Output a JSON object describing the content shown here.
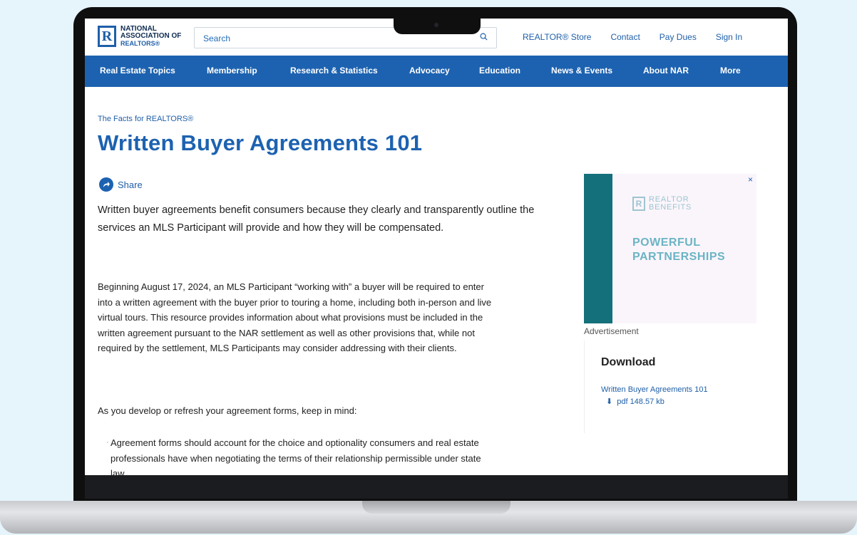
{
  "header": {
    "logo": {
      "line1": "NATIONAL",
      "line2": "ASSOCIATION OF",
      "line3": "REALTORS®"
    },
    "search_placeholder": "Search",
    "links": [
      "REALTOR® Store",
      "Contact",
      "Pay Dues",
      "Sign In"
    ]
  },
  "nav": {
    "items": [
      "Real Estate Topics",
      "Membership",
      "Research & Statistics",
      "Advocacy",
      "Education",
      "News & Events",
      "About NAR",
      "More"
    ]
  },
  "article": {
    "kicker": "The Facts for REALTORS®",
    "title": "Written Buyer Agreements 101",
    "share_label": "Share",
    "intro": "Written buyer agreements benefit consumers because they clearly and transparently outline the services an MLS Participant will provide and how they will be compensated.",
    "paragraph": "Beginning August 17, 2024, an MLS Participant “working with” a buyer will be required to enter into a written agreement with the buyer prior to touring a home, including both in-person and live virtual tours. This resource provides information about what provisions must be included in the written agreement pursuant to the NAR settlement as well as other provisions that, while not required by the settlement, MLS Participants may consider addressing with their clients.",
    "paragraph2": "As you develop or refresh your agreement forms, keep in mind:",
    "bullet": "Agreement forms should account for the choice and optionality consumers and real estate professionals have when negotiating the terms of their relationship permissible under state law."
  },
  "ad": {
    "logo_line1": "REALTOR",
    "logo_line2": "BENEFITS",
    "headline_line1": "POWERFUL",
    "headline_line2": "PARTNERSHIPS",
    "close": "×",
    "label": "Advertisement"
  },
  "download": {
    "title": "Download",
    "link": "Written Buyer Agreements 101",
    "meta": "pdf 148.57 kb"
  },
  "colors": {
    "brand_blue": "#1d62b0",
    "ad_teal": "#14707b"
  }
}
